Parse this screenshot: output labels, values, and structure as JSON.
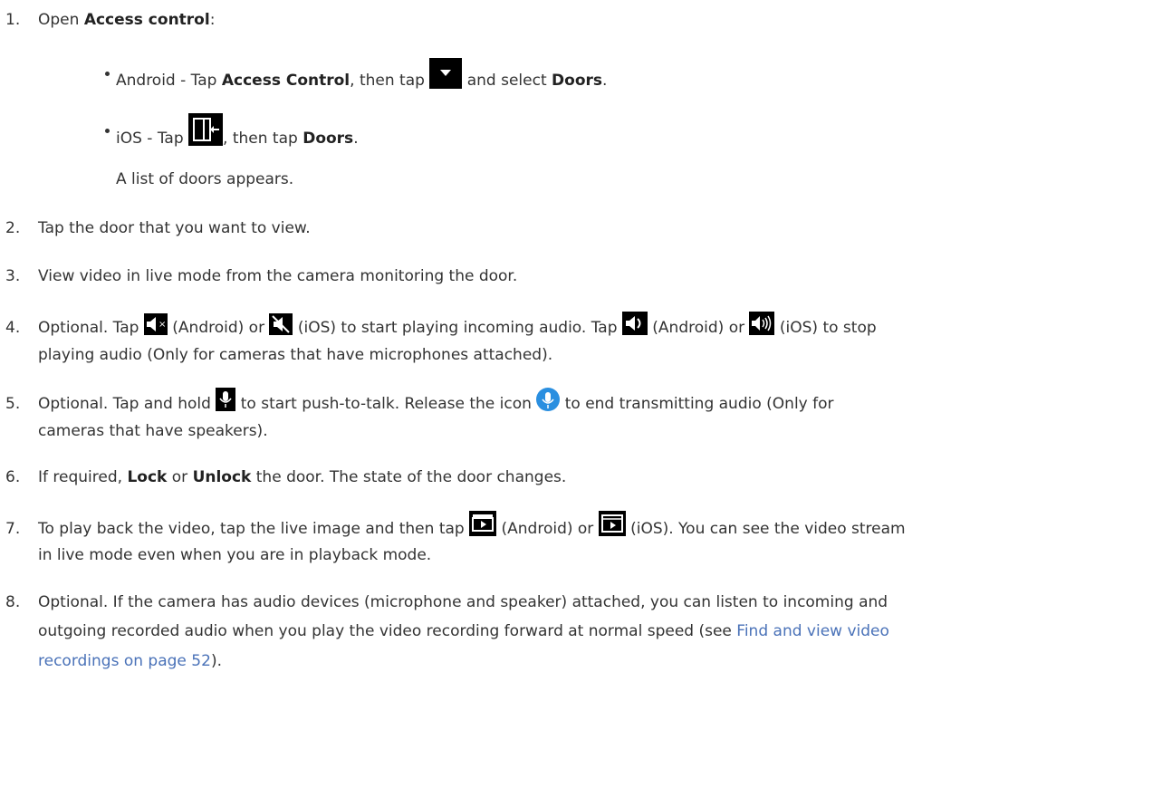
{
  "steps": {
    "s1": {
      "num": "1.",
      "a": "Open ",
      "b": "Access control",
      "c": ":"
    },
    "android": {
      "a": "Android - Tap ",
      "b": "Access Control",
      "c": ", then tap ",
      "d": " and select ",
      "e": "Doors",
      "f": "."
    },
    "ios": {
      "a": "iOS - Tap ",
      "b": ", then tap ",
      "c": "Doors",
      "d": "."
    },
    "list_note": "A list of doors appears.",
    "s2": {
      "num": "2.",
      "text": "Tap the door that you want to view."
    },
    "s3": {
      "num": "3.",
      "text": "View video in live mode from the camera monitoring the door."
    },
    "s4": {
      "num": "4.",
      "a": "Optional. Tap ",
      "b": " (Android) or ",
      "c": " (iOS) to start playing incoming audio. Tap ",
      "d": " (Android) or ",
      "e": " (iOS) to stop",
      "line2": "playing audio (Only for cameras that have microphones attached)."
    },
    "s5": {
      "num": "5.",
      "a": "Optional. Tap and hold ",
      "b": " to start push-to-talk. Release the icon ",
      "c": " to end transmitting audio (Only for",
      "line2": "cameras that have speakers)."
    },
    "s6": {
      "num": "6.",
      "a": "If required, ",
      "b": "Lock",
      "c": " or ",
      "d": "Unlock",
      "e": " the door. The state of the door changes."
    },
    "s7": {
      "num": "7.",
      "a": "To play back the video, tap the live image and then tap ",
      "b": " (Android) or ",
      "c": " (iOS). You can see the video stream",
      "line2": "in live mode even when you are in playback mode."
    },
    "s8": {
      "num": "8.",
      "line1": "Optional. If the camera has audio devices (microphone and speaker) attached, you can listen to incoming and",
      "line2a": "outgoing recorded audio when you play the video recording forward at normal speed (see ",
      "link1": "Find and view video",
      "link2": "recordings on page 52",
      "line3b": ")."
    }
  },
  "icons": {
    "dropdown": "dropdown-arrow-icon",
    "door": "door-exit-icon",
    "mute_android": "speaker-muted-icon",
    "mute_ios": "speaker-crossed-icon",
    "audio_android": "speaker-on-icon",
    "audio_ios": "speaker-waves-icon",
    "mic": "microphone-icon",
    "mic_active": "microphone-active-icon",
    "playback_android": "playback-clapper-icon",
    "playback_ios": "playback-film-icon"
  },
  "colors": {
    "link": "#4a72b8",
    "mic_active": "#2a8fe0"
  }
}
